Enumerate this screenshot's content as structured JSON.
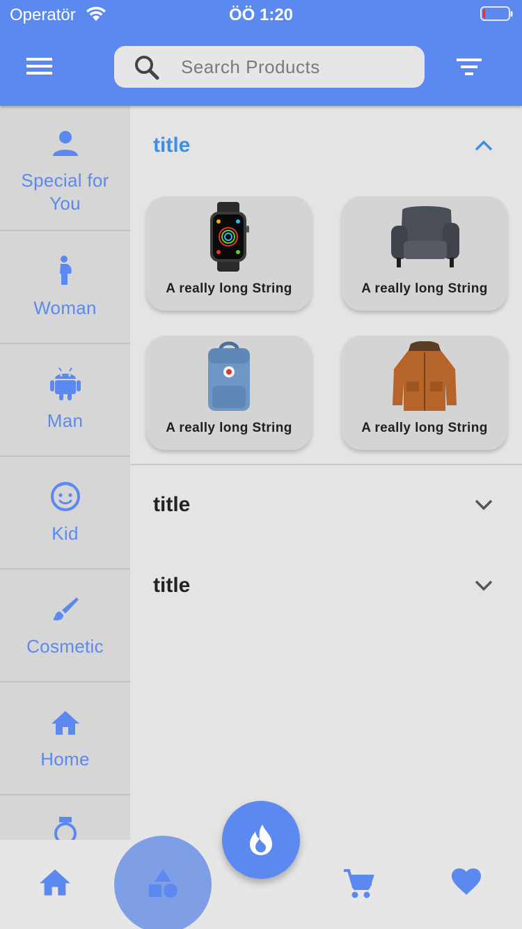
{
  "status_bar": {
    "carrier": "Operatör",
    "time": "ÖÖ 1:20"
  },
  "header": {
    "search_placeholder": "Search Products"
  },
  "sidebar": {
    "items": [
      {
        "label": "Special for You",
        "icon": "person-icon"
      },
      {
        "label": "Woman",
        "icon": "pregnant-woman-icon"
      },
      {
        "label": "Man",
        "icon": "android-icon"
      },
      {
        "label": "Kid",
        "icon": "child-face-icon"
      },
      {
        "label": "Cosmetic",
        "icon": "brush-icon"
      },
      {
        "label": "Home",
        "icon": "home-icon"
      }
    ]
  },
  "sections": [
    {
      "title": "title",
      "expanded": true,
      "products": [
        {
          "label": "A really long String",
          "image": "smartwatch"
        },
        {
          "label": "A really long String",
          "image": "armchair"
        },
        {
          "label": "A really long String",
          "image": "backpack"
        },
        {
          "label": "A really long String",
          "image": "jacket"
        }
      ]
    },
    {
      "title": "title",
      "expanded": false
    },
    {
      "title": "title",
      "expanded": false
    }
  ],
  "bottom_nav": {
    "items": [
      "home-icon",
      "categories-icon",
      "cart-icon",
      "heart-icon"
    ],
    "selected": "categories-icon",
    "fab_icon": "flame-icon"
  },
  "colors": {
    "primary": "#5c89ef",
    "active_title": "#3f8ee6",
    "background": "#e4e4e4",
    "sidebar": "#d6d6d6"
  }
}
